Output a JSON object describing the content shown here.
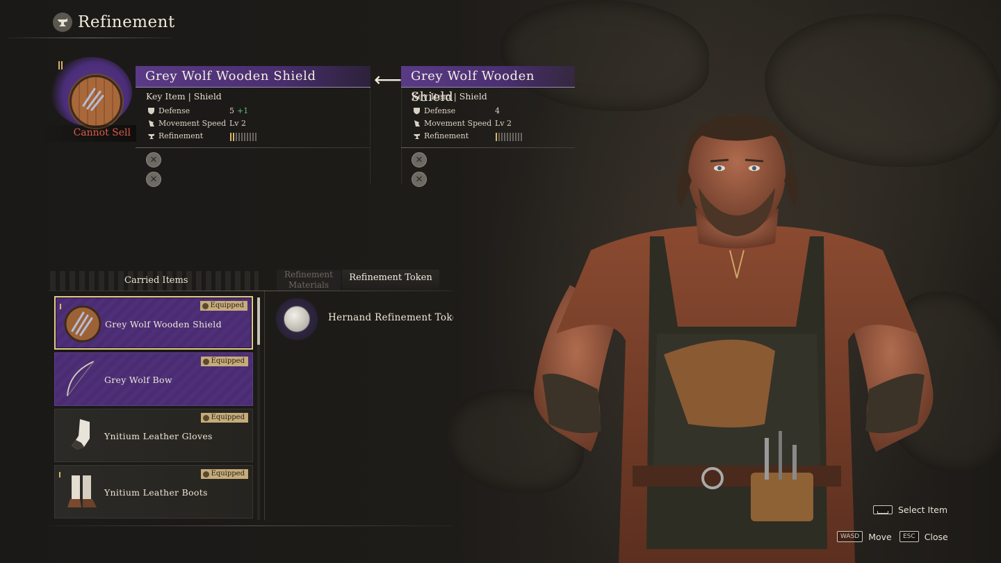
{
  "header": {
    "title": "Refinement",
    "icon": "anvil-icon"
  },
  "preview": {
    "status": "Cannot Sell",
    "current": {
      "name": "Grey Wolf Wooden Shield",
      "subtitle": "Key Item | Shield",
      "stats": [
        {
          "label": "Defense",
          "value": "5",
          "bonus": "+1",
          "icon": "shield-icon"
        },
        {
          "label": "Movement Speed",
          "value": "Lv 2",
          "icon": "boot-icon"
        },
        {
          "label": "Refinement",
          "icon": "anvil-icon",
          "level": 2,
          "max": 10
        }
      ]
    },
    "before": {
      "name": "Grey Wolf Wooden Shield",
      "subtitle": "Key Item | Shield",
      "stats": [
        {
          "label": "Defense",
          "value": "4",
          "icon": "shield-icon"
        },
        {
          "label": "Movement Speed",
          "value": "Lv 2",
          "icon": "boot-icon"
        },
        {
          "label": "Refinement",
          "icon": "anvil-icon",
          "level": 1,
          "max": 10
        }
      ]
    }
  },
  "tabs": {
    "carried": "Carried Items",
    "materials": "Refinement Materials",
    "token": "Refinement Token"
  },
  "items": [
    {
      "name": "Grey Wolf Wooden Shield",
      "badge": "Equipped",
      "style": "purple",
      "selected": true
    },
    {
      "name": "Grey Wolf Bow",
      "badge": "Equipped",
      "style": "purple",
      "selected": false
    },
    {
      "name": "Ynitium Leather Gloves",
      "badge": "Equipped",
      "style": "plain",
      "selected": false
    },
    {
      "name": "Ynitium Leather Boots",
      "badge": "Equipped",
      "style": "plain",
      "selected": false
    }
  ],
  "token": {
    "name": "Hernand Refinement Token"
  },
  "controls": {
    "select": {
      "key_icon": "space-key-icon",
      "label": "Select Item"
    },
    "move": {
      "key": "WASD",
      "label": "Move"
    },
    "close": {
      "key": "ESC",
      "label": "Close"
    }
  },
  "colors": {
    "accent_purple": "#5a3a86",
    "gold": "#d9b768",
    "warning_red": "#e05a4a",
    "bonus_green": "#62c07a"
  }
}
